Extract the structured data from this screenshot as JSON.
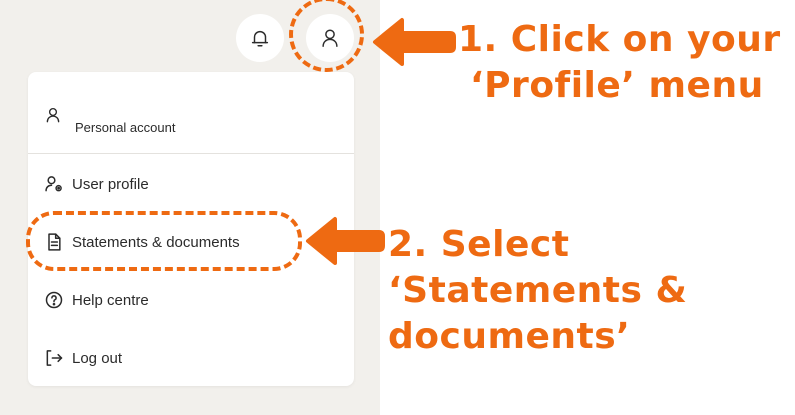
{
  "header": {
    "icons": [
      "bell-icon",
      "user-icon"
    ]
  },
  "menu": {
    "account_label": "Personal account",
    "items": [
      {
        "label": "User profile",
        "icon": "user-settings-icon"
      },
      {
        "label": "Statements & documents",
        "icon": "document-icon"
      },
      {
        "label": "Help centre",
        "icon": "help-icon"
      },
      {
        "label": "Log out",
        "icon": "logout-icon"
      }
    ]
  },
  "annotations": {
    "step1": [
      "1. Click on your",
      "‘Profile’ menu"
    ],
    "step2": [
      "2. Select",
      "‘Statements &",
      "documents’"
    ]
  },
  "colors": {
    "accent": "#ee6a12",
    "app_background": "#f2f0ec",
    "text": "#2b2b2b"
  }
}
